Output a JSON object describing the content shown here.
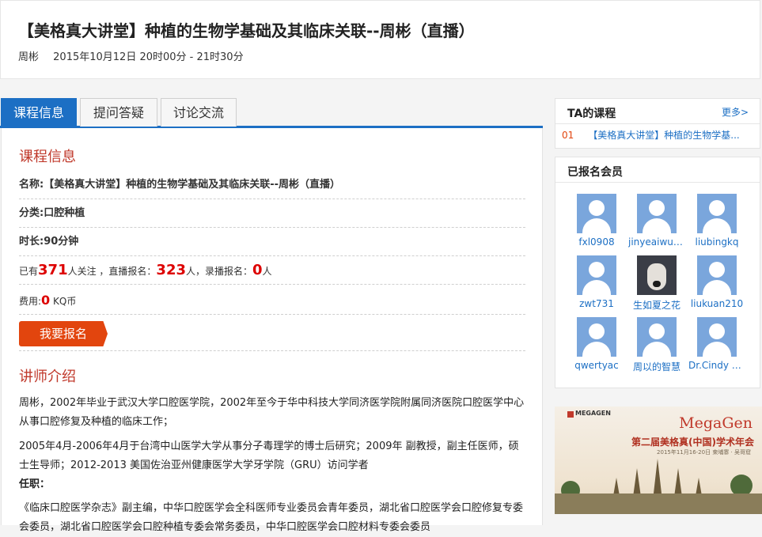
{
  "header": {
    "title": "【美格真大讲堂】种植的生物学基础及其临床关联--周彬（直播）",
    "teacher": "周彬",
    "datetime": "2015年10月12日 20时00分 - 21时30分"
  },
  "tabs": [
    "课程信息",
    "提问答疑",
    "讨论交流"
  ],
  "course_info": {
    "heading": "课程信息",
    "name_label": "名称:",
    "name_value": "【美格真大讲堂】种植的生物学基础及其临床关联--周彬（直播）",
    "category_label": "分类:",
    "category_value": "口腔种植",
    "duration_label": "时长:",
    "duration_value": "90分钟",
    "stats": {
      "prefix": "已有",
      "followers": "371",
      "followers_suffix": "人关注 ，直播报名：",
      "live_signups": "323",
      "live_suffix": "人，录播报名：",
      "recorded_signups": "0",
      "recorded_suffix": "人"
    },
    "fee_label": "费用:",
    "fee_value": "0",
    "fee_unit": "KQ币",
    "signup_button": "我要报名"
  },
  "teacher_intro": {
    "heading": "讲师介绍",
    "para1": "周彬，2002年毕业于武汉大学口腔医学院，2002年至今于华中科技大学同济医学院附属同济医院口腔医学中心从事口腔修复及种植的临床工作；",
    "para2": "2005年4月-2006年4月于台湾中山医学大学从事分子毒理学的博士后研究；2009年 副教授，副主任医师，硕士生导师；2012-2013 美国佐治亚州健康医学大学牙学院（GRU）访问学者",
    "para3_label": "任职：",
    "para4": "《临床口腔医学杂志》副主编，中华口腔医学会全科医师专业委员会青年委员，湖北省口腔医学会口腔修复专委会委员，湖北省口腔医学会口腔种植专委会常务委员，中华口腔医学会口腔材料专委会委员"
  },
  "sidebar": {
    "courses_title": "TA的课程",
    "more_label": "更多>",
    "courses": [
      {
        "num": "01",
        "title": "【美格真大讲堂】种植的生物学基..."
      }
    ],
    "members_title": "已报名会员",
    "members": [
      {
        "name": "fxl0908"
      },
      {
        "name": "jinyeaiwuh..."
      },
      {
        "name": "liubingkq"
      },
      {
        "name": "zwt731"
      },
      {
        "name": "生如夏之花"
      },
      {
        "name": "liukuan210"
      },
      {
        "name": "qwertyac"
      },
      {
        "name": "周以的智慧"
      },
      {
        "name": "Dr.Cindy w..."
      }
    ]
  },
  "banner": {
    "logo": "MEGAGEN",
    "brand": "MegaGen",
    "title": "第二届美格真(中国)学术年会",
    "subtitle": "2015年11月16-20日 柬埔寨 · 吴哥窟"
  },
  "colors": {
    "accent_blue": "#1c6fc4",
    "signup_orange": "#e2450e",
    "heading_red": "#c0392b",
    "stat_red": "#dd0000"
  }
}
